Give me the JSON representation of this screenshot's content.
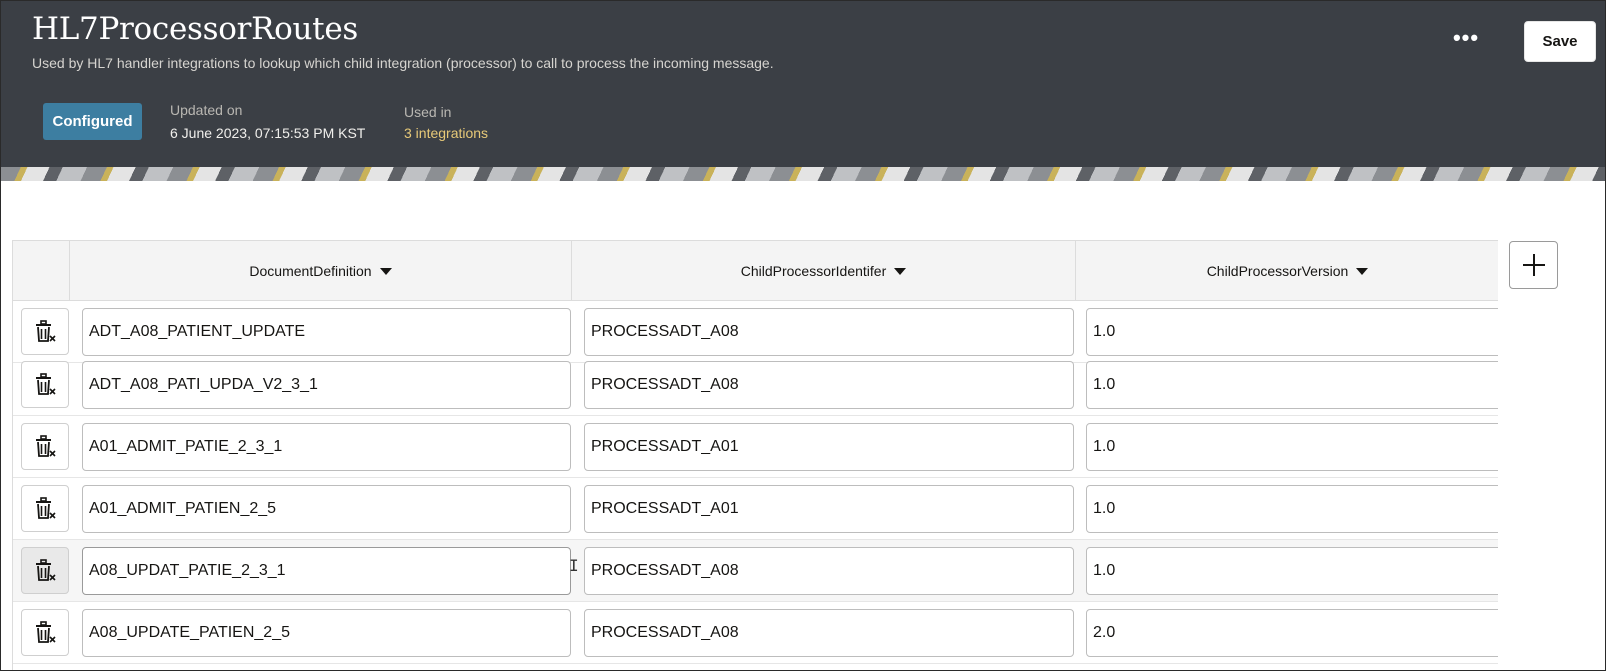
{
  "header": {
    "title": "HL7ProcessorRoutes",
    "subtitle": "Used by HL7 handler integrations to lookup which child integration (processor) to call to process the incoming message.",
    "more_label": "•••",
    "save_label": "Save",
    "status_badge": "Configured",
    "updated_label": "Updated on",
    "updated_value": "6 June 2023, 07:15:53 PM KST",
    "used_label": "Used in",
    "used_value": "3 integrations"
  },
  "table": {
    "columns": [
      "DocumentDefinition",
      "ChildProcessorIdentifer",
      "ChildProcessorVersion"
    ],
    "rows": [
      {
        "doc": "ADT_A08_PATIENT_UPDATE",
        "proc": "PROCESSADT_A08",
        "ver": "1.0"
      },
      {
        "doc": "ADT_A08_PATI_UPDA_V2_3_1",
        "proc": "PROCESSADT_A08",
        "ver": "1.0"
      },
      {
        "doc": "A01_ADMIT_PATIE_2_3_1",
        "proc": "PROCESSADT_A01",
        "ver": "1.0"
      },
      {
        "doc": "A01_ADMIT_PATIEN_2_5",
        "proc": "PROCESSADT_A01",
        "ver": "1.0"
      },
      {
        "doc": "A08_UPDAT_PATIE_2_3_1",
        "proc": "PROCESSADT_A08",
        "ver": "1.0"
      },
      {
        "doc": "A08_UPDATE_PATIEN_2_5",
        "proc": "PROCESSADT_A08",
        "ver": "2.0"
      }
    ],
    "highlighted_row": 4
  },
  "icons": {
    "delete": "trash-icon",
    "add": "plus-icon",
    "sort": "caret-down-icon",
    "cursor": "text-cursor-icon"
  },
  "colors": {
    "header_bg": "#3b3f45",
    "badge_bg": "#3d7ea1",
    "link": "#e7c978"
  }
}
